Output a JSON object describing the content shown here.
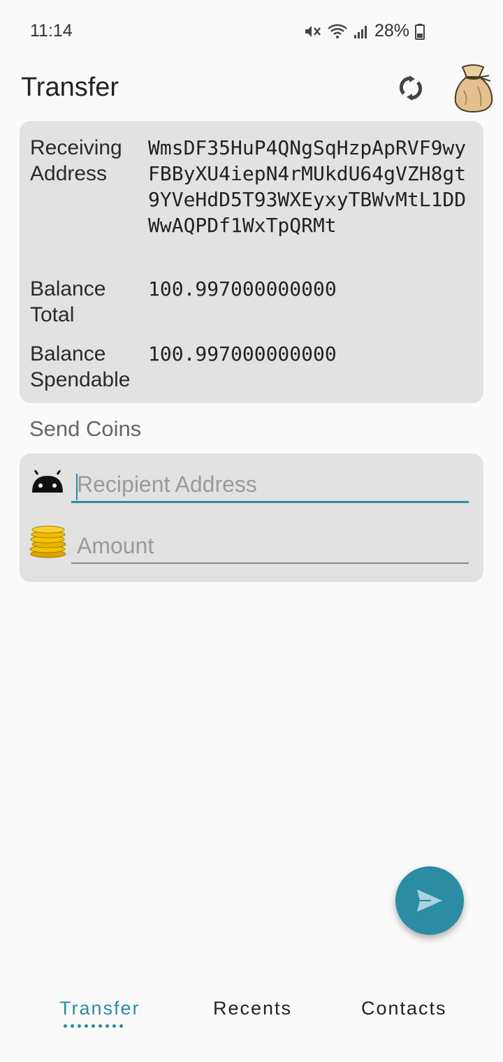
{
  "status_bar": {
    "time": "11:14",
    "battery": "28%"
  },
  "app_bar": {
    "title": "Transfer",
    "refresh_icon": "refresh-icon",
    "wallet_icon": "money-bag-icon"
  },
  "info": {
    "receiving_label": "Receiving Address",
    "receiving_value": "WmsDF35HuP4QNgSqHzpApRVF9wyFBByXU4iepN4rMUkdU64gVZH8gt9YVeHdD5T93WXEyxyTBWvMtL1DDWwAQPDf1WxTpQRMt",
    "balance_total_label": "Balance Total",
    "balance_total_value": "100.997000000000",
    "balance_spendable_label": "Balance Spendable",
    "balance_spendable_value": "100.997000000000"
  },
  "send": {
    "section_label": "Send Coins",
    "recipient_placeholder": "Recipient Address",
    "amount_placeholder": "Amount",
    "recipient_icon": "android-icon",
    "amount_icon": "coins-icon"
  },
  "fab": {
    "icon": "send-icon"
  },
  "nav": {
    "transfer": "Transfer",
    "recents": "Recents",
    "contacts": "Contacts"
  },
  "colors": {
    "accent": "#2b8ca3",
    "card": "#e2e2e2",
    "background": "#fafafa"
  }
}
